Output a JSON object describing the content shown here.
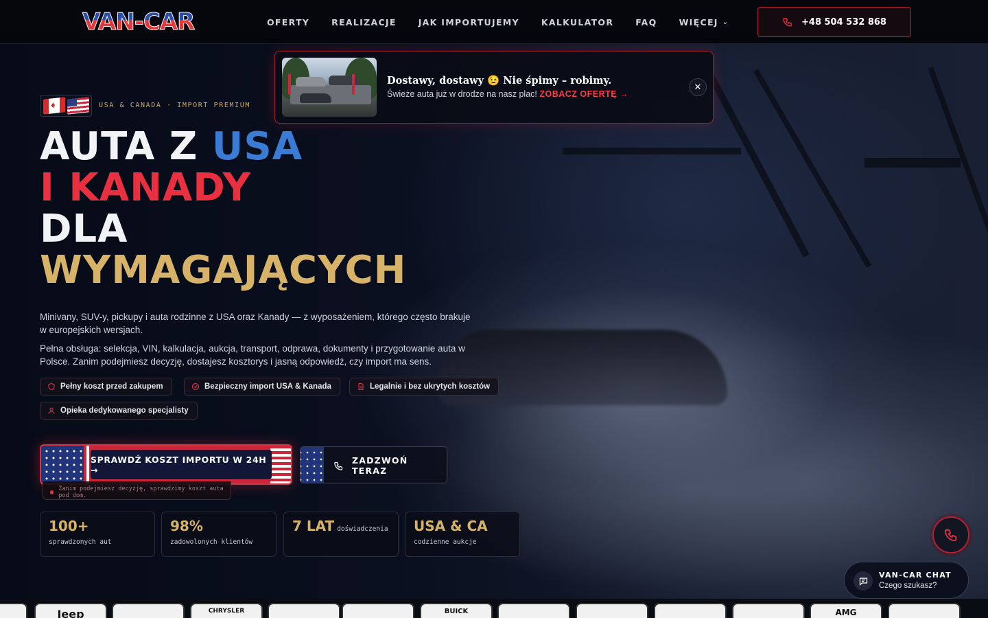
{
  "header": {
    "logo": "VAN-CAR",
    "nav": [
      "OFERTY",
      "REALIZACJE",
      "JAK IMPORTUJEMY",
      "KALKULATOR",
      "FAQ",
      "WIĘCEJ"
    ],
    "phone": "+48 504 532 868"
  },
  "notification": {
    "title": "Dostawy, dostawy 😉 Nie śpimy – robimy.",
    "text": "Świeże auta już w drodze na nasz plac!",
    "link": "ZOBACZ OFERTĘ →"
  },
  "hero": {
    "tagline": "USA & CANADA · IMPORT PREMIUM",
    "title_1a": "AUTA Z ",
    "title_1b": "USA",
    "title_2": "I KANADY",
    "title_3": "DLA",
    "title_4": "WYMAGAJĄCYCH",
    "paragraph_1": "Minivany, SUV-y, pickupy i auta rodzinne z USA oraz Kanady — z wyposażeniem, którego często brakuje w europejskich wersjach.",
    "paragraph_2": "Pełna obsługa: selekcja, VIN, kalkulacja, aukcja, transport, odprawa, dokumenty i przygotowanie auta w Polsce. Zanim podejmiesz decyzję, dostajesz kosztorys i jasną odpowiedź, czy import ma sens.",
    "chips": [
      "Pełny koszt przed zakupem",
      "Bezpieczny import USA & Kanada",
      "Legalnie i bez ukrytych kosztów",
      "Opieka dedykowanego specjalisty"
    ],
    "cta_primary": "SPRAWDŹ KOSZT IMPORTU W 24H →",
    "cta_note": "Zanim podejmiesz decyzję, sprawdzimy koszt auta pod dom.",
    "cta_secondary": "ZADZWOŃ TERAZ"
  },
  "stats": [
    {
      "value": "100+",
      "suffix": "",
      "label": "sprawdzonych aut"
    },
    {
      "value": "98%",
      "suffix": "",
      "label": "zadowolonych klientów"
    },
    {
      "value": "7 LAT",
      "suffix": "doświadczenia",
      "label": ""
    },
    {
      "value": "USA & CA",
      "suffix": "",
      "label": "codzienne aukcje"
    }
  ],
  "chat": {
    "title": "VAN-CAR CHAT",
    "subtitle": "Czego szukasz?"
  },
  "brands": [
    "Jeep",
    "",
    "CHRYSLER",
    "",
    "",
    "BUICK",
    "",
    "",
    "",
    "",
    "AMG",
    ""
  ],
  "colors": {
    "accent_red": "#e83040",
    "accent_blue": "#3a7bd5",
    "accent_gold": "#d7b36a",
    "background": "#060912"
  }
}
